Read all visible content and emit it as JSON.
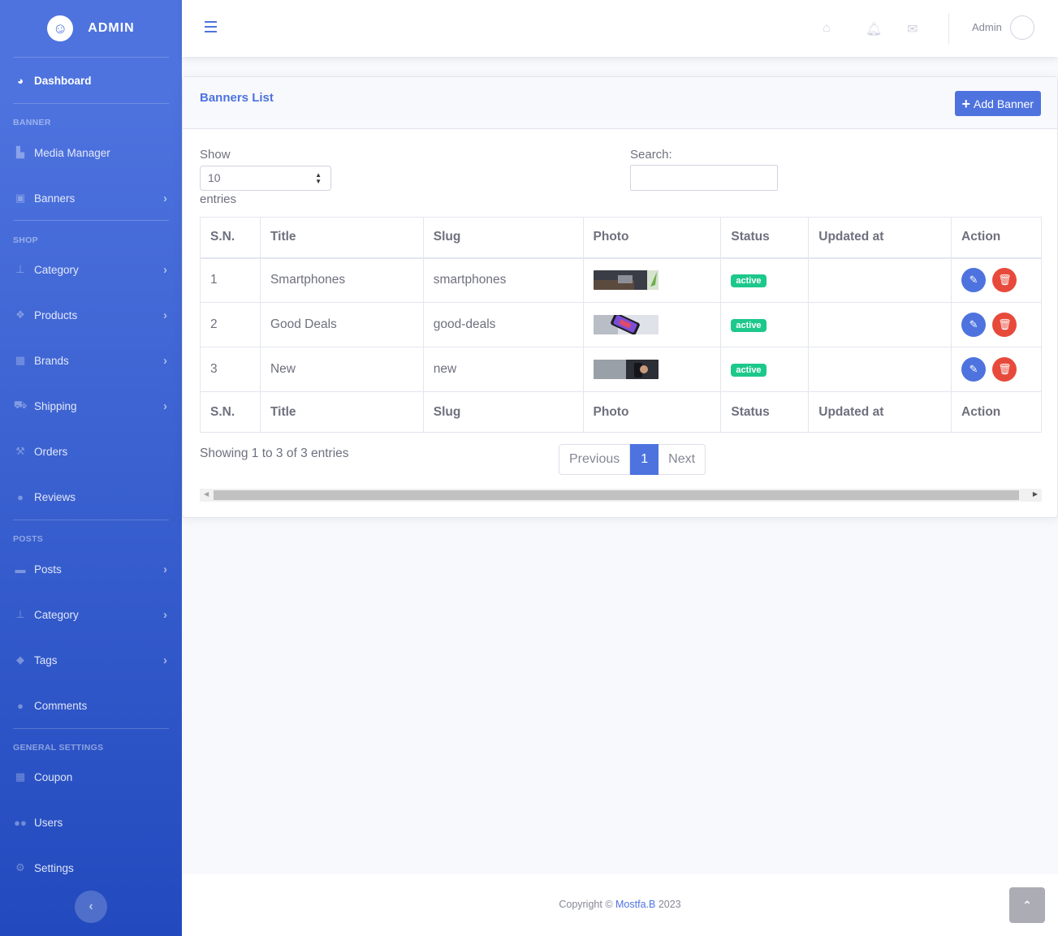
{
  "sidebar": {
    "brand": "ADMIN",
    "dashboard": "Dashboard",
    "headings": {
      "banner": "BANNER",
      "shop": "SHOP",
      "posts": "POSTS",
      "general": "GENERAL SETTINGS"
    },
    "items": {
      "media_manager": "Media Manager",
      "banners": "Banners",
      "category": "Category",
      "products": "Products",
      "brands": "Brands",
      "shipping": "Shipping",
      "orders": "Orders",
      "reviews": "Reviews",
      "posts": "Posts",
      "post_category": "Category",
      "tags": "Tags",
      "comments": "Comments",
      "coupon": "Coupon",
      "users": "Users",
      "settings": "Settings"
    }
  },
  "topbar": {
    "user_name": "Admin"
  },
  "card": {
    "title": "Banners List",
    "add_button": "Add Banner",
    "show_label": "Show",
    "entries_value": "10",
    "entries_label": "entries",
    "search_label": "Search:"
  },
  "table": {
    "columns": [
      "S.N.",
      "Title",
      "Slug",
      "Photo",
      "Status",
      "Updated at",
      "Action"
    ],
    "rows": [
      {
        "sn": "1",
        "title": "Smartphones",
        "slug": "smartphones",
        "status": "active",
        "updated": ""
      },
      {
        "sn": "2",
        "title": "Good Deals",
        "slug": "good-deals",
        "status": "active",
        "updated": ""
      },
      {
        "sn": "3",
        "title": "New",
        "slug": "new",
        "status": "active",
        "updated": ""
      }
    ],
    "info": "Showing 1 to 3 of 3 entries",
    "pager": {
      "prev": "Previous",
      "current": "1",
      "next": "Next"
    }
  },
  "footer": {
    "prefix": "Copyright ©",
    "author": "Mostfa.B",
    "year": "2023"
  },
  "colors": {
    "primary": "#4e73df",
    "success": "#1cc88a",
    "danger": "#e74a3b"
  }
}
